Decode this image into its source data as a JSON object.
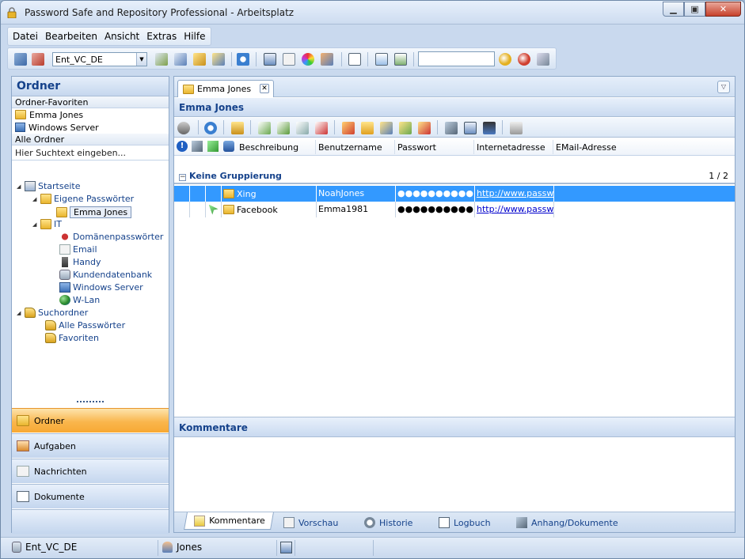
{
  "window": {
    "title": "Password Safe and Repository Professional - Arbeitsplatz",
    "minimize": "▁",
    "maximize": "▣",
    "close": "✕"
  },
  "menu": [
    "Datei",
    "Bearbeiten",
    "Ansicht",
    "Extras",
    "Hilfe"
  ],
  "toolbar": {
    "database_value": "Ent_VC_DE",
    "search_value": ""
  },
  "left": {
    "title": "Ordner",
    "favorites_header": "Ordner-Favoriten",
    "favorites": [
      "Emma Jones",
      "Windows Server"
    ],
    "all_header": "Alle Ordner",
    "search_placeholder": "Hier Suchtext eingeben...",
    "tree": {
      "startseite": "Startseite",
      "eigene": "Eigene Passwörter",
      "emma": "Emma Jones",
      "it": "IT",
      "it_children": [
        "Domänenpasswörter",
        "Email",
        "Handy",
        "Kundendatenbank",
        "Windows Server",
        "W-Lan"
      ],
      "suchordner": "Suchordner",
      "such_children": [
        "Alle Passwörter",
        "Favoriten"
      ]
    },
    "nav": [
      "Ordner",
      "Aufgaben",
      "Nachrichten",
      "Dokumente"
    ]
  },
  "right": {
    "tab_label": "Emma Jones",
    "panel_title": "Emma Jones",
    "columns": [
      "Beschreibung",
      "Benutzername",
      "Passwort",
      "Internetadresse",
      "EMail-Adresse"
    ],
    "group_label": "Keine Gruppierung",
    "group_count": "1 / 2",
    "rows": [
      {
        "beschreibung": "Xing",
        "benutzername": "NoahJones",
        "passwort": "●●●●●●●●●●",
        "internetadresse": "http://www.passwo",
        "email": ""
      },
      {
        "beschreibung": "Facebook",
        "benutzername": "Emma1981",
        "passwort": "●●●●●●●●●●",
        "internetadresse": "http://www.passwo",
        "email": ""
      }
    ],
    "comments_title": "Kommentare",
    "bottom_tabs": [
      "Kommentare",
      "Vorschau",
      "Historie",
      "Logbuch",
      "Anhang/Dokumente"
    ]
  },
  "status": {
    "database": "Ent_VC_DE",
    "user": "Jones"
  }
}
